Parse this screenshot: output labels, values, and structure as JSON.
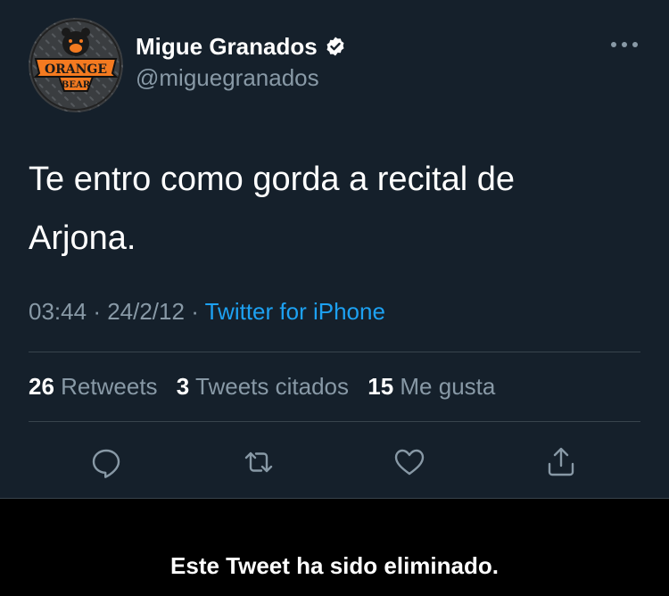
{
  "author": {
    "display_name": "Migue Granados",
    "handle": "@miguegranados",
    "avatar_logo": {
      "line1": "ORANGE",
      "line2": "BEAR"
    }
  },
  "tweet": {
    "text": "Te entro como gorda a recital de\nArjona.",
    "time": "03:44",
    "date": "24/2/12",
    "source": "Twitter for iPhone"
  },
  "stats": [
    {
      "count": "26",
      "label": "Retweets"
    },
    {
      "count": "3",
      "label": "Tweets citados"
    },
    {
      "count": "15",
      "label": "Me gusta"
    }
  ],
  "actions": [
    "reply-icon",
    "retweet-icon",
    "like-icon",
    "share-icon"
  ],
  "banner": {
    "text": "Este Tweet ha sido eliminado."
  },
  "colors": {
    "background": "#15202b",
    "secondary_text": "#8899a6",
    "link": "#1da1f2",
    "divider": "#38444d",
    "banner_bg": "#000000"
  }
}
